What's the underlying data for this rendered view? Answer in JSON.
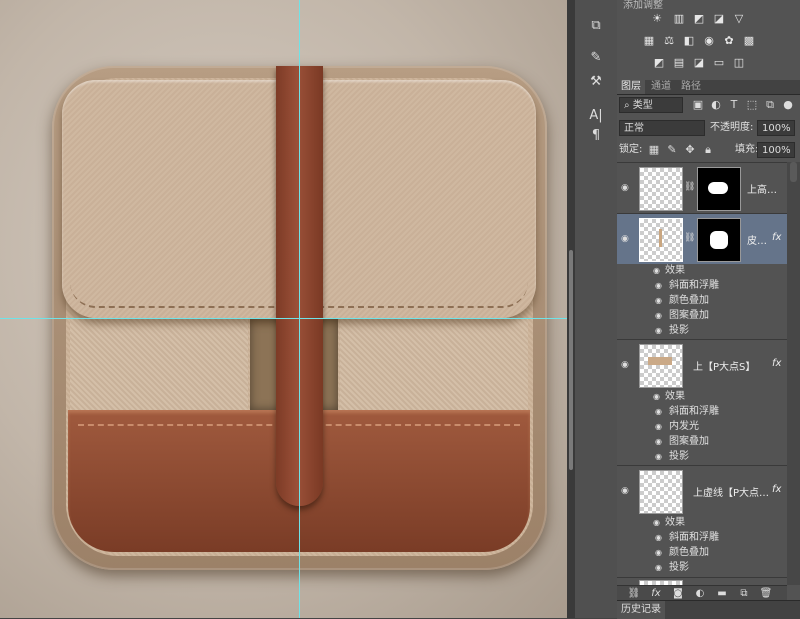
{
  "adjustments": {
    "title": "添加调整",
    "icons_row1": [
      "brightness-icon",
      "levels-icon",
      "curves-icon",
      "exposure-icon",
      "vibrance-icon"
    ],
    "icons_row2": [
      "hue-icon",
      "color-balance-icon",
      "bw-icon",
      "photo-filter-icon",
      "channel-mixer-icon",
      "lookup-icon"
    ],
    "icons_row3": [
      "invert-icon",
      "posterize-icon",
      "threshold-icon",
      "gradient-map-icon",
      "selective-color-icon"
    ]
  },
  "layers_panel": {
    "tabs": [
      {
        "label": "图层"
      },
      {
        "label": "通道"
      },
      {
        "label": "路径"
      }
    ],
    "filter_type": "类型",
    "blend_mode": "正常",
    "opacity_label": "不透明度:",
    "opacity_value": "100%",
    "lock_label": "锁定:",
    "fill_label": "填充:",
    "fill_value": "100%",
    "layers": [
      {
        "name": "上高…",
        "fx": ""
      },
      {
        "name": "皮…",
        "fx": "fx"
      },
      {
        "name": "上【P大点S】",
        "fx": "fx"
      },
      {
        "name": "上虚线【P大点…",
        "fx": "fx"
      }
    ],
    "effects": {
      "header": "效果",
      "layer2": [
        "斜面和浮雕",
        "颜色叠加",
        "图案叠加",
        "投影"
      ],
      "layer3": [
        "斜面和浮雕",
        "内发光",
        "图案叠加",
        "投影"
      ],
      "layer4": [
        "斜面和浮雕",
        "颜色叠加",
        "投影"
      ]
    },
    "footer_icons": [
      "link-icon",
      "fx-icon",
      "mask-icon",
      "adjustment-icon",
      "group-icon",
      "new-layer-icon",
      "trash-icon"
    ]
  },
  "history_panel": {
    "tab": "历史记录"
  }
}
